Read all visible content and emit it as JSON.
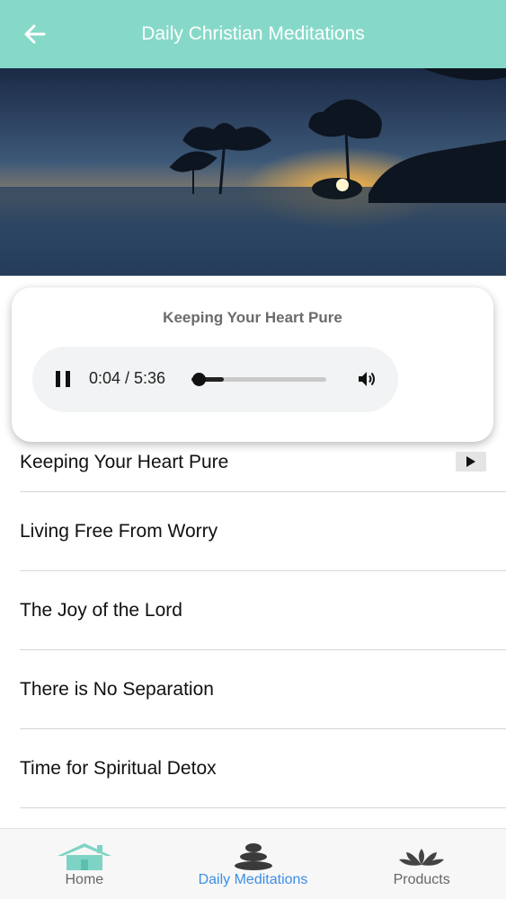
{
  "header": {
    "title": "Daily Christian Meditations",
    "back_icon": "arrow-left-icon"
  },
  "hero": {
    "image": "sunset-over-lake-with-trees"
  },
  "player": {
    "title": "Keeping Your Heart Pure",
    "time": "0:04 / 5:36",
    "progress_fraction": 0.012,
    "buffered_fraction": 0.24,
    "pause_icon": "pause-icon",
    "volume_icon": "volume-icon"
  },
  "meditations": [
    {
      "title": "Keeping Your Heart Pure",
      "has_play": true
    },
    {
      "title": "Living Free From Worry"
    },
    {
      "title": "The Joy of the Lord"
    },
    {
      "title": "There is No Separation"
    },
    {
      "title": "Time for Spiritual Detox"
    }
  ],
  "nav": {
    "home": {
      "label": "Home",
      "icon": "house-icon"
    },
    "meditations": {
      "label": "Daily Meditations",
      "icon": "meditation-stones-icon"
    },
    "products": {
      "label": "Products",
      "icon": "lotus-icon"
    },
    "active": "meditations"
  },
  "colors": {
    "header": "#86d9c8",
    "active_nav": "#3b8ee8",
    "home_icon": "#7dd4c5"
  }
}
